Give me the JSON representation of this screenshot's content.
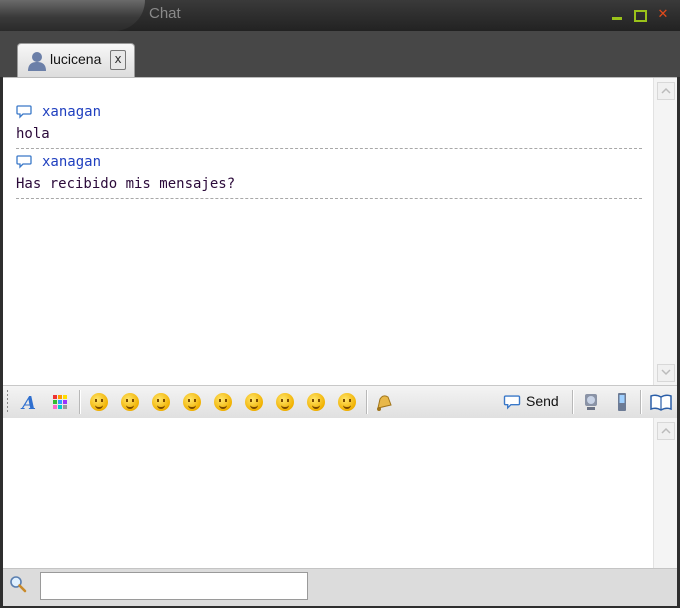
{
  "window": {
    "title": "Chat"
  },
  "tab": {
    "label": "lucicena",
    "close_label": "x"
  },
  "messages": [
    {
      "sender": "xanagan",
      "text": "hola"
    },
    {
      "sender": "xanagan",
      "text": "Has recibido mis mensajes?"
    }
  ],
  "toolbar": {
    "font_icon": "font-icon",
    "color_icon": "color-palette-icon",
    "emoticons": [
      "smile",
      "grin",
      "laugh",
      "big-grin",
      "wink",
      "surprised",
      "tongue",
      "sad",
      "confused"
    ],
    "nudge_icon": "bell-icon",
    "send_label": "Send",
    "webcam_icon": "webcam-icon",
    "mobile_icon": "mobile-icon",
    "book_icon": "book-icon"
  },
  "input": {
    "value": ""
  },
  "search": {
    "value": ""
  },
  "colors": {
    "sender": "#1f3fbf",
    "message_text": "#2b0a3a",
    "min_max": "#9ac21a",
    "close": "#e34a1a"
  }
}
